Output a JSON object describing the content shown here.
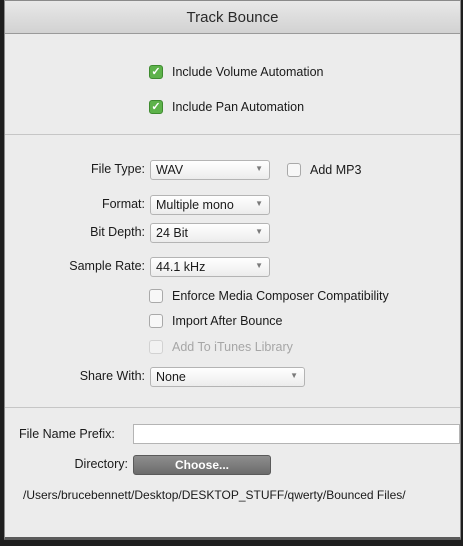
{
  "window": {
    "title": "Track Bounce"
  },
  "automation": {
    "volume": {
      "label": "Include Volume Automation",
      "checked": true
    },
    "pan": {
      "label": "Include Pan Automation",
      "checked": true
    }
  },
  "settings": {
    "file_type": {
      "label": "File Type:",
      "value": "WAV"
    },
    "add_mp3": {
      "label": "Add MP3",
      "checked": false
    },
    "format": {
      "label": "Format:",
      "value": "Multiple mono"
    },
    "bit_depth": {
      "label": "Bit Depth:",
      "value": "24 Bit"
    },
    "sample_rate": {
      "label": "Sample Rate:",
      "value": "44.1 kHz"
    },
    "enforce": {
      "label": "Enforce Media Composer Compatibility",
      "checked": false
    },
    "import_after": {
      "label": "Import After Bounce",
      "checked": false
    },
    "itunes": {
      "label": "Add To iTunes Library",
      "checked": false,
      "disabled": true
    },
    "share_with": {
      "label": "Share With:",
      "value": "None"
    }
  },
  "file": {
    "prefix_label": "File Name Prefix:",
    "prefix_value": "",
    "directory_label": "Directory:",
    "choose_label": "Choose...",
    "path": "/Users/brucebennett/Desktop/DESKTOP_STUFF/qwerty/Bounced Files/"
  },
  "colors": {
    "check_on": "#5db24a",
    "button": "#7a7a7a"
  }
}
